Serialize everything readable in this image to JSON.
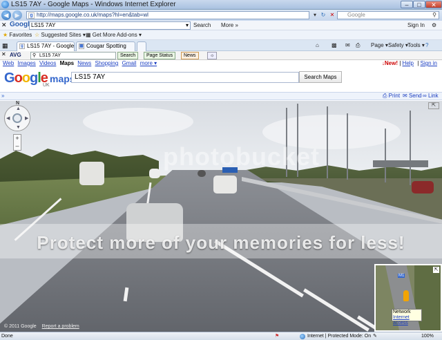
{
  "window": {
    "title": "LS15 7AY - Google Maps - Windows Internet Explorer"
  },
  "address": {
    "url": "http://maps.google.co.uk/maps?hl=en&tab=wl"
  },
  "websearch": {
    "placeholder": "Google"
  },
  "gtoolbar": {
    "logo": "Google",
    "query": "LS15 7AY",
    "search_label": "Search",
    "more_label": "More »",
    "signin_label": "Sign In"
  },
  "favorites": {
    "favorites_label": "Favorites",
    "suggested_label": "Suggested Sites ▾",
    "addons_label": "Get More Add-ons ▾"
  },
  "tabs": [
    {
      "label": "LS15 7AY - Google Maps"
    },
    {
      "label": "Cougar Spotting"
    }
  ],
  "commandbar": {
    "page": "Page ▾",
    "safety": "Safety ▾",
    "tools": "Tools ▾",
    "help": "?"
  },
  "avg": {
    "logo": "AVG",
    "search_value": "LS15 7AY",
    "search_btn": "Search",
    "page_status": "Page Status",
    "news": "News"
  },
  "gnav": {
    "items": [
      "Web",
      "Images",
      "Videos",
      "Maps",
      "News",
      "Shopping",
      "Gmail",
      "more ▾"
    ],
    "new_label": "New!",
    "help": "Help",
    "signin": "Sign in"
  },
  "maps": {
    "logo": "Google",
    "product": "maps",
    "region": "UK",
    "query": "LS15 7AY",
    "search_button": "Search Maps"
  },
  "linkbar": {
    "print": "Print",
    "send": "Send",
    "link": "Link"
  },
  "streetview": {
    "compass": "N",
    "copyright": "© 2011 Google",
    "report": "Report a problem",
    "watermark_top": "photobucket",
    "watermark": "Protect more of your memories for less!"
  },
  "minimap": {
    "label": "M1"
  },
  "tooltip": {
    "line1": "Network",
    "line2": "Internet access"
  },
  "status": {
    "left": "Done",
    "zone": "Internet | Protected Mode: On",
    "zoom": "100%"
  }
}
